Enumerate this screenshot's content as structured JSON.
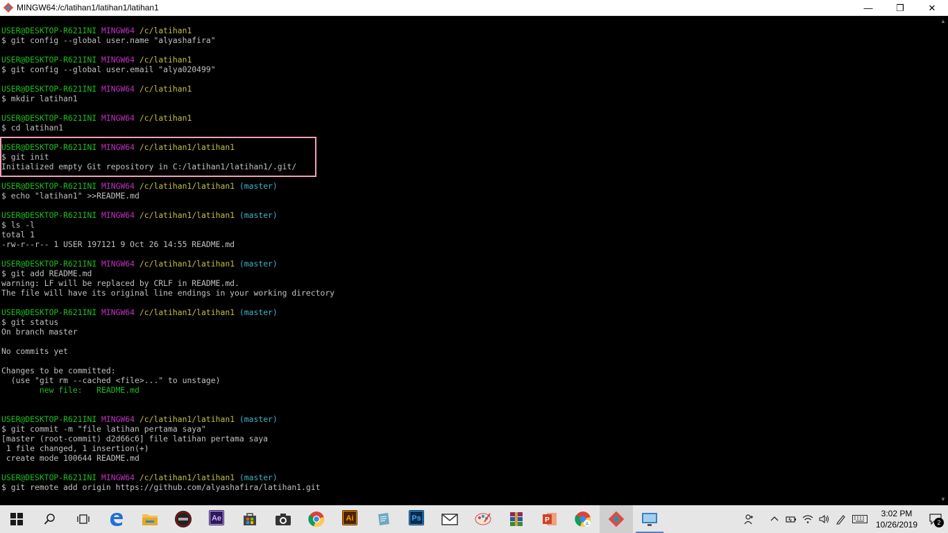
{
  "window": {
    "title": "MINGW64:/c/latihan1/latihan1/latihan1",
    "minimize_label": "—",
    "restore_label": "❐",
    "close_label": "✕"
  },
  "terminal": {
    "lines": [
      [
        {
          "t": "USER@DESKTOP-R621INI",
          "c": "green"
        },
        {
          "t": " ",
          "c": "white"
        },
        {
          "t": "MINGW64",
          "c": "magenta"
        },
        {
          "t": " ",
          "c": "white"
        },
        {
          "t": "/c/latihan1",
          "c": "yellow"
        }
      ],
      [
        {
          "t": "$ git config --global user.name \"alyashafira\"",
          "c": "white"
        }
      ],
      [],
      [
        {
          "t": "USER@DESKTOP-R621INI",
          "c": "green"
        },
        {
          "t": " ",
          "c": "white"
        },
        {
          "t": "MINGW64",
          "c": "magenta"
        },
        {
          "t": " ",
          "c": "white"
        },
        {
          "t": "/c/latihan1",
          "c": "yellow"
        }
      ],
      [
        {
          "t": "$ git config --global user.email \"alya020499\"",
          "c": "white"
        }
      ],
      [],
      [
        {
          "t": "USER@DESKTOP-R621INI",
          "c": "green"
        },
        {
          "t": " ",
          "c": "white"
        },
        {
          "t": "MINGW64",
          "c": "magenta"
        },
        {
          "t": " ",
          "c": "white"
        },
        {
          "t": "/c/latihan1",
          "c": "yellow"
        }
      ],
      [
        {
          "t": "$ mkdir latihan1",
          "c": "white"
        }
      ],
      [],
      [
        {
          "t": "USER@DESKTOP-R621INI",
          "c": "green"
        },
        {
          "t": " ",
          "c": "white"
        },
        {
          "t": "MINGW64",
          "c": "magenta"
        },
        {
          "t": " ",
          "c": "white"
        },
        {
          "t": "/c/latihan1",
          "c": "yellow"
        }
      ],
      [
        {
          "t": "$ cd latihan1",
          "c": "white"
        }
      ],
      [],
      [
        {
          "t": "USER@DESKTOP-R621INI",
          "c": "green"
        },
        {
          "t": " ",
          "c": "white"
        },
        {
          "t": "MINGW64",
          "c": "magenta"
        },
        {
          "t": " ",
          "c": "white"
        },
        {
          "t": "/c/latihan1/latihan1",
          "c": "yellow"
        }
      ],
      [
        {
          "t": "$ git init",
          "c": "white"
        }
      ],
      [
        {
          "t": "Initialized empty Git repository in C:/latihan1/latihan1/.git/",
          "c": "white"
        }
      ],
      [],
      [
        {
          "t": "USER@DESKTOP-R621INI",
          "c": "green"
        },
        {
          "t": " ",
          "c": "white"
        },
        {
          "t": "MINGW64",
          "c": "magenta"
        },
        {
          "t": " ",
          "c": "white"
        },
        {
          "t": "/c/latihan1/latihan1",
          "c": "yellow"
        },
        {
          "t": " (master)",
          "c": "cyan"
        }
      ],
      [
        {
          "t": "$ echo \"latihan1\" >>README.md",
          "c": "white"
        }
      ],
      [],
      [
        {
          "t": "USER@DESKTOP-R621INI",
          "c": "green"
        },
        {
          "t": " ",
          "c": "white"
        },
        {
          "t": "MINGW64",
          "c": "magenta"
        },
        {
          "t": " ",
          "c": "white"
        },
        {
          "t": "/c/latihan1/latihan1",
          "c": "yellow"
        },
        {
          "t": " (master)",
          "c": "cyan"
        }
      ],
      [
        {
          "t": "$ ls -l",
          "c": "white"
        }
      ],
      [
        {
          "t": "total 1",
          "c": "white"
        }
      ],
      [
        {
          "t": "-rw-r--r-- 1 USER 197121 9 Oct 26 14:55 README.md",
          "c": "white"
        }
      ],
      [],
      [
        {
          "t": "USER@DESKTOP-R621INI",
          "c": "green"
        },
        {
          "t": " ",
          "c": "white"
        },
        {
          "t": "MINGW64",
          "c": "magenta"
        },
        {
          "t": " ",
          "c": "white"
        },
        {
          "t": "/c/latihan1/latihan1",
          "c": "yellow"
        },
        {
          "t": " (master)",
          "c": "cyan"
        }
      ],
      [
        {
          "t": "$ git add README.md",
          "c": "white"
        }
      ],
      [
        {
          "t": "warning: LF will be replaced by CRLF in README.md.",
          "c": "white"
        }
      ],
      [
        {
          "t": "The file will have its original line endings in your working directory",
          "c": "white"
        }
      ],
      [],
      [
        {
          "t": "USER@DESKTOP-R621INI",
          "c": "green"
        },
        {
          "t": " ",
          "c": "white"
        },
        {
          "t": "MINGW64",
          "c": "magenta"
        },
        {
          "t": " ",
          "c": "white"
        },
        {
          "t": "/c/latihan1/latihan1",
          "c": "yellow"
        },
        {
          "t": " (master)",
          "c": "cyan"
        }
      ],
      [
        {
          "t": "$ git status",
          "c": "white"
        }
      ],
      [
        {
          "t": "On branch master",
          "c": "white"
        }
      ],
      [],
      [
        {
          "t": "No commits yet",
          "c": "white"
        }
      ],
      [],
      [
        {
          "t": "Changes to be committed:",
          "c": "white"
        }
      ],
      [
        {
          "t": "  (use \"git rm --cached <file>...\" to unstage)",
          "c": "white"
        }
      ],
      [
        {
          "t": "        new file:   README.md",
          "c": "green"
        }
      ],
      [],
      [],
      [
        {
          "t": "USER@DESKTOP-R621INI",
          "c": "green"
        },
        {
          "t": " ",
          "c": "white"
        },
        {
          "t": "MINGW64",
          "c": "magenta"
        },
        {
          "t": " ",
          "c": "white"
        },
        {
          "t": "/c/latihan1/latihan1",
          "c": "yellow"
        },
        {
          "t": " (master)",
          "c": "cyan"
        }
      ],
      [
        {
          "t": "$ git commit -m \"file latihan pertama saya\"",
          "c": "white"
        }
      ],
      [
        {
          "t": "[master (root-commit) d2d66c6] file latihan pertama saya",
          "c": "white"
        }
      ],
      [
        {
          "t": " 1 file changed, 1 insertion(+)",
          "c": "white"
        }
      ],
      [
        {
          "t": " create mode 100644 README.md",
          "c": "white"
        }
      ],
      [],
      [
        {
          "t": "USER@DESKTOP-R621INI",
          "c": "green"
        },
        {
          "t": " ",
          "c": "white"
        },
        {
          "t": "MINGW64",
          "c": "magenta"
        },
        {
          "t": " ",
          "c": "white"
        },
        {
          "t": "/c/latihan1/latihan1",
          "c": "yellow"
        },
        {
          "t": " (master)",
          "c": "cyan"
        }
      ],
      [
        {
          "t": "$ git remote add origin https://github.com/alyashafira/latihan1.git",
          "c": "white"
        }
      ]
    ]
  },
  "taskbar": {
    "apps": [
      {
        "name": "start-button",
        "icon": "windows-icon",
        "color": "#1a1a1a",
        "interact": true
      },
      {
        "name": "search-button",
        "icon": "search-icon",
        "color": "#1a1a1a",
        "interact": true
      },
      {
        "name": "task-view-button",
        "icon": "task-view-icon",
        "color": "#1a1a1a",
        "interact": true
      },
      {
        "name": "edge-app",
        "icon": "edge-icon",
        "color": "#1e6fd9",
        "interact": true
      },
      {
        "name": "file-explorer-app",
        "icon": "folder-icon",
        "color": "#f2c14e",
        "interact": true
      },
      {
        "name": "asus-app",
        "icon": "asus-icon",
        "color": "#222222",
        "interact": true
      },
      {
        "name": "after-effects-app",
        "icon": "after-effects-icon",
        "color": "#2b1b5a",
        "label": "Ae",
        "interact": true
      },
      {
        "name": "store-app",
        "icon": "store-icon",
        "color": "#444444",
        "interact": true
      },
      {
        "name": "camera-app",
        "icon": "camera-icon",
        "color": "#333333",
        "interact": true
      },
      {
        "name": "chrome-app",
        "icon": "chrome-icon",
        "color": "#db4437",
        "interact": true
      },
      {
        "name": "illustrator-app",
        "icon": "illustrator-icon",
        "color": "#4a2300",
        "label": "Ai",
        "interact": true
      },
      {
        "name": "notepad-app",
        "icon": "notepad-icon",
        "color": "#6aa7c4",
        "interact": true
      },
      {
        "name": "photoshop-app",
        "icon": "photoshop-icon",
        "color": "#0a2a4a",
        "label": "Ps",
        "interact": true
      },
      {
        "name": "mail-app",
        "icon": "mail-icon",
        "color": "#333333",
        "interact": true
      },
      {
        "name": "paint-app",
        "icon": "paint-icon",
        "color": "#d04060",
        "interact": true
      },
      {
        "name": "winrar-app",
        "icon": "winrar-icon",
        "color": "#8a2a5a",
        "interact": true
      },
      {
        "name": "powerpoint-app",
        "icon": "powerpoint-icon",
        "color": "#d04423",
        "interact": true
      },
      {
        "name": "chrome-apps-app",
        "icon": "chrome-apps-icon",
        "color": "#0f9d58",
        "interact": true
      },
      {
        "name": "git-bash-app",
        "icon": "git-icon",
        "color": "#e8473a",
        "active": true,
        "interact": true
      },
      {
        "name": "remote-app",
        "icon": "monitor-icon",
        "color": "#3a7fc4",
        "running": true,
        "interact": true
      }
    ],
    "tray": {
      "time": "3:02 PM",
      "date": "10/26/2019",
      "notification_count": "2"
    }
  }
}
